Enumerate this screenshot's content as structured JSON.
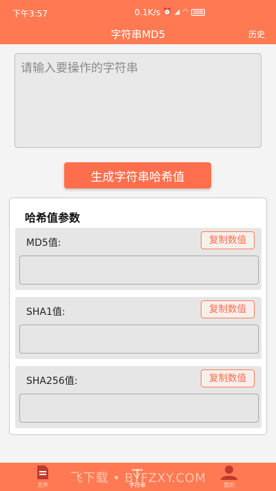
{
  "status": {
    "time": "下午3:57",
    "net_speed": "0.1K/s",
    "battery": "100"
  },
  "header": {
    "title": "字符串MD5",
    "history_label": "历史"
  },
  "input": {
    "placeholder": "请输入要操作的字符串",
    "value": ""
  },
  "generate_button_label": "生成字符串哈希值",
  "hash_card": {
    "title": "哈希值参数",
    "blocks": [
      {
        "label": "MD5值:",
        "copy_label": "复制数值",
        "value": ""
      },
      {
        "label": "SHA1值:",
        "copy_label": "复制数值",
        "value": ""
      },
      {
        "label": "SHA256值:",
        "copy_label": "复制数值",
        "value": ""
      }
    ]
  },
  "bottom_nav": {
    "items": [
      {
        "label": "文件",
        "icon": "document-icon"
      },
      {
        "label": "字符串",
        "icon": "text-icon"
      },
      {
        "label": "我的",
        "icon": "user-icon"
      }
    ],
    "accent": "#c0392b"
  },
  "watermark": "飞下载 • BYFZXY.COM",
  "colors": {
    "primary": "#ff7a52",
    "button": "#ff6f4d",
    "background": "#f4f4f4"
  }
}
